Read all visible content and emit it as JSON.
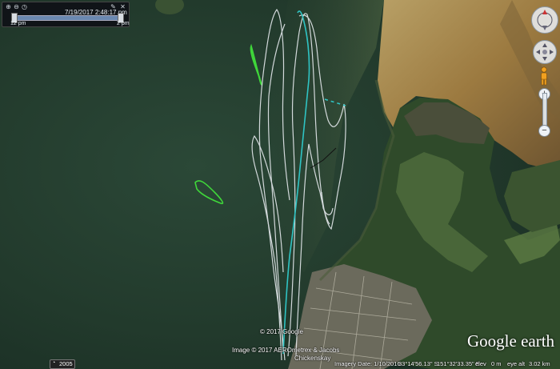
{
  "time_slider": {
    "current_time": "7/19/2017   2:48:17 pm",
    "range_start": "12 pm",
    "range_end": "2 pm"
  },
  "toolbar_icons": [
    "zoom-in-icon",
    "zoom-out-icon",
    "clock-icon",
    "wrench-icon",
    "close-icon"
  ],
  "navigation": {
    "zoom_in": "+",
    "zoom_out": "−"
  },
  "map": {
    "place_label": "Chickenskay",
    "copyright_1": "© 2017 Google",
    "copyright_2": "Image © 2017 AEROmetrex & Jacobs",
    "logo": "Google earth"
  },
  "status_bar": {
    "year": "2005",
    "imagery_date": "Imagery Date: 1/10/2016",
    "latitude": "33°14'56.13\" S",
    "longitude": "151°32'33.35\" E",
    "elevation_label": "elev",
    "elevation_value": "0 m",
    "eye_alt_label": "eye alt",
    "eye_alt_value": "3.02 km"
  },
  "colors": {
    "water": "#24402f",
    "sand": "#a98a4e",
    "vegetation": "#2e4a28",
    "track_white": "#e8ecef",
    "track_cyan": "#2fc4c4",
    "track_green": "#3fd63a"
  }
}
